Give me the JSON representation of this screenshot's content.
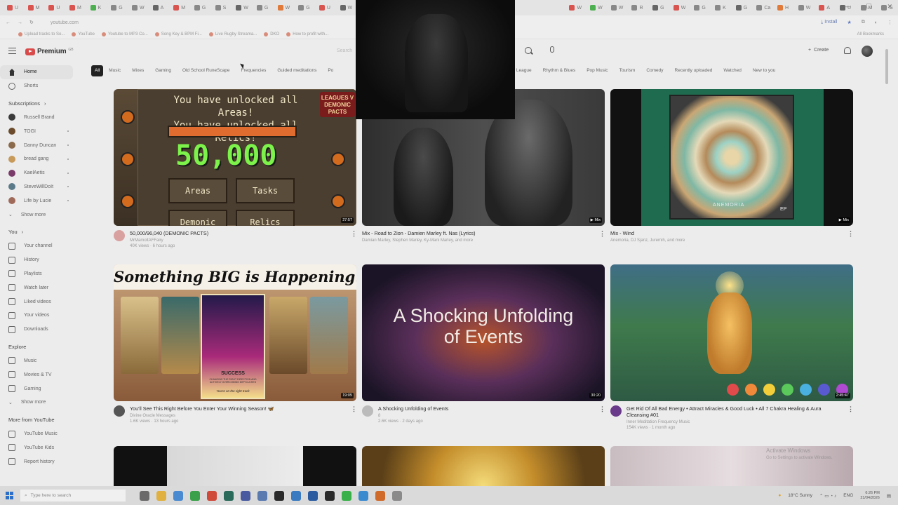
{
  "browser": {
    "tabs": [
      "U",
      "M",
      "U",
      "M",
      "K",
      "G",
      "W",
      "A",
      "M",
      "G",
      "S",
      "W",
      "G",
      "W",
      "G",
      "U",
      "W",
      "G",
      "G"
    ],
    "tabs_right": [
      "W",
      "W",
      "W",
      "R",
      "G",
      "W",
      "G",
      "K",
      "G",
      "Ca",
      "H",
      "W",
      "A",
      "U",
      "M",
      "G"
    ],
    "url": "youtube.com",
    "install_label": "Install",
    "bookmarks": [
      "Upload tracks to So...",
      "YouTube",
      "Youtube to MP3 Co...",
      "Song Key & BPM Fi...",
      "Live Rugby Streama...",
      "DKO",
      "How to profit with..."
    ],
    "all_bookmarks": "All Bookmarks"
  },
  "header": {
    "logo_text": "Premium",
    "logo_sup": "GB",
    "search_placeholder": "Search",
    "create_label": "Create"
  },
  "sidebar": {
    "main": [
      {
        "label": "Home",
        "icon": "home-icon"
      },
      {
        "label": "Shorts",
        "icon": "shorts-icon"
      }
    ],
    "subscriptions_title": "Subscriptions",
    "subscriptions": [
      {
        "label": "Russell Brand",
        "color": "#3a3a3a"
      },
      {
        "label": "TOGI",
        "color": "#6b4b2b"
      },
      {
        "label": "Danny Duncan",
        "color": "#8a6a4a"
      },
      {
        "label": "bread gang",
        "color": "#c79a5a"
      },
      {
        "label": "KaelAetis",
        "color": "#7a3a6a"
      },
      {
        "label": "SteveWillDoIt",
        "color": "#5a7a8a"
      },
      {
        "label": "Life by Lucie",
        "color": "#a06a5a"
      }
    ],
    "show_more": "Show more",
    "you_title": "You",
    "you_items": [
      {
        "label": "Your channel",
        "icon": "channel-icon"
      },
      {
        "label": "History",
        "icon": "history-icon"
      },
      {
        "label": "Playlists",
        "icon": "playlists-icon"
      },
      {
        "label": "Watch later",
        "icon": "watch-later-icon"
      },
      {
        "label": "Liked videos",
        "icon": "liked-icon"
      },
      {
        "label": "Your videos",
        "icon": "your-videos-icon"
      },
      {
        "label": "Downloads",
        "icon": "downloads-icon"
      }
    ],
    "explore_title": "Explore",
    "explore_items": [
      {
        "label": "Music",
        "icon": "music-icon"
      },
      {
        "label": "Movies & TV",
        "icon": "movies-icon"
      },
      {
        "label": "Gaming",
        "icon": "gaming-icon"
      }
    ],
    "more_title": "More from YouTube",
    "more_items": [
      {
        "label": "YouTube Music",
        "icon": "youtube-music-icon"
      },
      {
        "label": "YouTube Kids",
        "icon": "youtube-kids-icon"
      },
      {
        "label": "Report history",
        "icon": "report-icon"
      }
    ]
  },
  "chips": [
    "All",
    "Music",
    "Mixes",
    "Gaming",
    "Old School RuneScape",
    "Frequencies",
    "Guided meditations",
    "Po",
    "Rugby League",
    "Rhythm & Blues",
    "Pop Music",
    "Tourism",
    "Comedy",
    "Recently uploaded",
    "Watched",
    "New to you"
  ],
  "videos": [
    {
      "title": "50,000/96,040 (DEMONIC PACTS)",
      "channel": "MrMamoltAFFairy",
      "stats": "40K views · 6 hours ago",
      "duration": "27:57",
      "avatar_color": "#d9a0a0"
    },
    {
      "title": "Mix - Road to Zion - Damien Marley ft. Nas (Lyrics)",
      "channel": "Damian Marley, Stephen Marley, Ky-Mani Marley, and more",
      "stats": "",
      "duration": "Mix",
      "avatar_color": ""
    },
    {
      "title": "Mix - Wind",
      "channel": "Anemoria, DJ Sjanz, Juremih, and more",
      "stats": "",
      "duration": "Mix",
      "avatar_color": ""
    },
    {
      "title": "You'll See This Right Before You Enter Your Winning Season! 🦋",
      "channel": "Divine Oracle Messages",
      "stats": "1.6K views · 13 hours ago",
      "duration": "19:05",
      "avatar_color": "#555555"
    },
    {
      "title": "A Shocking Unfolding of Events",
      "channel": "8",
      "stats": "2.6K views · 2 days ago",
      "duration": "30:20",
      "avatar_color": "#bbbbbb"
    },
    {
      "title": "Get Rid Of All Bad Energy • Attract Miracles & Good Luck • All 7 Chakra Healing & Aura",
      "title2": "Cleansing #01",
      "channel": "Inner Meditation Frequency Music",
      "stats": "154K views · 1 month ago",
      "duration": "2:45:47",
      "avatar_color": "#6a3a8a"
    }
  ],
  "thumb_text": {
    "unlocked_line1": "You have unlocked all Areas!",
    "unlocked_line2": "You have unlocked all Relics!",
    "big_number": "50,000",
    "btn_areas": "Areas",
    "btn_tasks": "Tasks",
    "btn_demonic": "Demonic",
    "btn_relics": "Relics",
    "leagues_badge": "LEAGUES V DEMONIC PACTS",
    "something_big": "Something BIG is Happening!!",
    "card_success": "SUCCESS",
    "card_sub": "CHANGING THE RIGHT DIRECTION AND ACTIVELY OVERCOMING DIFFICULTIES",
    "card_right_track": "You're on the right track",
    "shocking_line1": "A Shocking Unfolding",
    "shocking_line2": "of Events",
    "anemoria": "ANEMORIA",
    "ep": "EP"
  },
  "taskbar": {
    "search_placeholder": "Type here to search",
    "weather": "18°C  Sunny",
    "lang": "ENG",
    "time": "6:26 PM",
    "date": "21/04/2026"
  },
  "watermark": {
    "line1": "Activate Windows",
    "line2": "Go to Settings to activate Windows."
  }
}
